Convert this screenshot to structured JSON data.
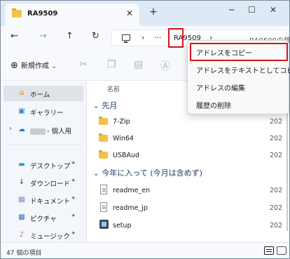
{
  "tab": {
    "title": "RA9509",
    "close": "✕",
    "new_tab": "+"
  },
  "window": {
    "minimize": "─",
    "maximize": "☐",
    "close": "✕"
  },
  "nav": {
    "back": "←",
    "forward": "→",
    "up": "↑",
    "refresh": "↻"
  },
  "address": {
    "separator1": "›",
    "more": "···",
    "crumb": "RA9509",
    "separator2": "›",
    "search_placeholder": "RA9509の検"
  },
  "command": {
    "new_label": "新規作成",
    "new_plus": "⊕",
    "new_chevron": "⌄",
    "icons": [
      "cut-icon",
      "copy-icon",
      "paste-icon",
      "rename-icon"
    ]
  },
  "sidebar": {
    "items": [
      {
        "label": "ホーム",
        "icon": "⌂"
      },
      {
        "label": "ギャラリー",
        "icon": "▣"
      },
      {
        "label": "- 個人用",
        "icon": "☁"
      },
      {
        "label": "デスクトップ",
        "icon": "▬"
      },
      {
        "label": "ダウンロード",
        "icon": "↓"
      },
      {
        "label": "ドキュメント",
        "icon": "▤"
      },
      {
        "label": "ピクチャ",
        "icon": "▩"
      },
      {
        "label": "ミュージック",
        "icon": "♪"
      }
    ],
    "pin": "📌"
  },
  "content": {
    "column_name": "名前",
    "groups": [
      {
        "label": "先月"
      },
      {
        "label": "今年に入って (今月は含めず)"
      }
    ],
    "rows": [
      {
        "name": "7-Zip",
        "date": "202"
      },
      {
        "name": "Win64",
        "date": "202"
      },
      {
        "name": "USBAud",
        "date": "202"
      },
      {
        "name": "readme_en",
        "date": "202"
      },
      {
        "name": "readme_jp",
        "date": "202"
      },
      {
        "name": "setup",
        "date": "202"
      }
    ]
  },
  "status": {
    "count": "47 個の項目"
  },
  "context_menu": {
    "items": [
      {
        "label": "アドレスをコピー"
      },
      {
        "label": "アドレスをテキストとしてコピー"
      },
      {
        "label": "アドレスの編集"
      },
      {
        "label": "履歴の削除"
      }
    ]
  },
  "colors": {
    "highlight_box": "#d8141b",
    "folder": "#f2c24a",
    "group_text": "#1f3b66"
  }
}
